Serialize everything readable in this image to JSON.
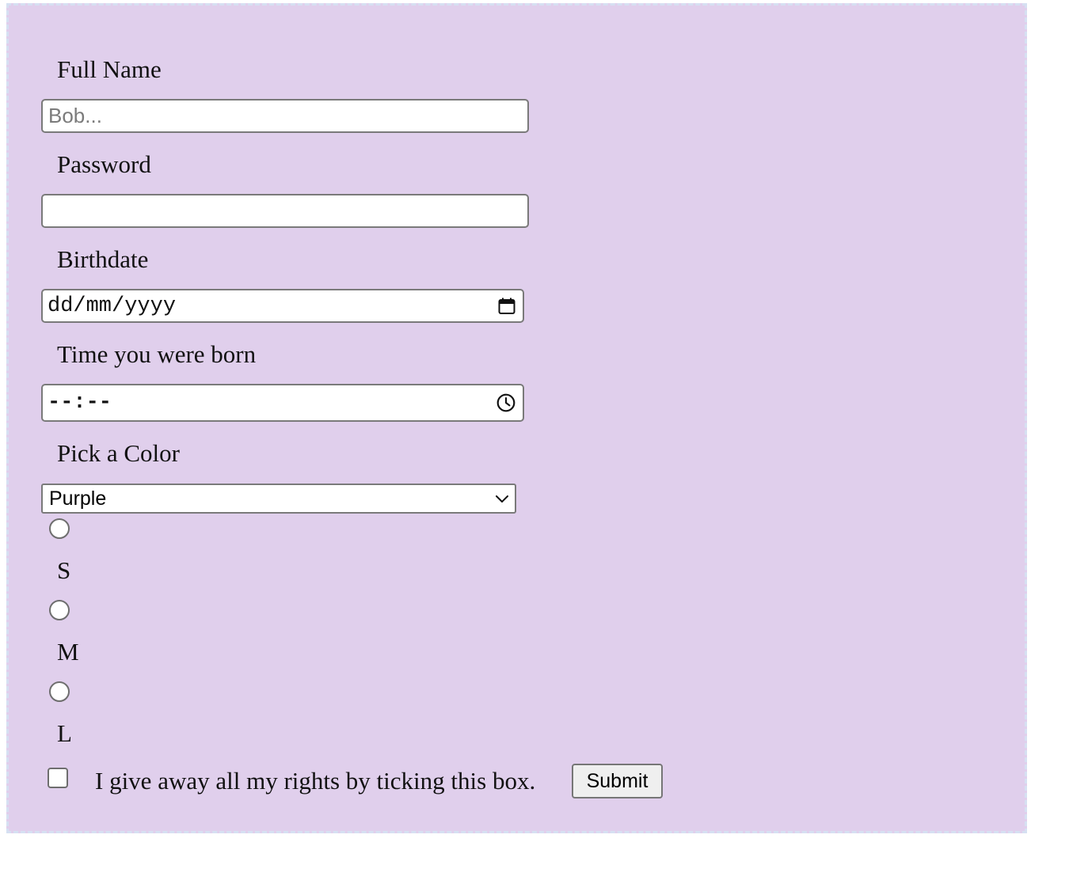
{
  "form": {
    "full_name": {
      "label": "Full Name",
      "placeholder": "Bob...",
      "value": ""
    },
    "password": {
      "label": "Password",
      "value": ""
    },
    "birthdate": {
      "label": "Birthdate",
      "display": "dd/mm/yyyy",
      "icon": "calendar-icon"
    },
    "birth_time": {
      "label": "Time you were born",
      "display": "--:--",
      "icon": "clock-icon"
    },
    "color": {
      "label": "Pick a Color",
      "selected": "Purple",
      "icon": "chevron-down-icon"
    },
    "sizes": [
      {
        "label": "S",
        "checked": false
      },
      {
        "label": "M",
        "checked": false
      },
      {
        "label": "L",
        "checked": false
      }
    ],
    "agreement": {
      "label": "I give away all my rights by ticking this box.",
      "checked": false
    },
    "submit_label": "Submit"
  },
  "colors": {
    "panel_background": "#e0cfec",
    "panel_border": "#d6e0f2"
  }
}
